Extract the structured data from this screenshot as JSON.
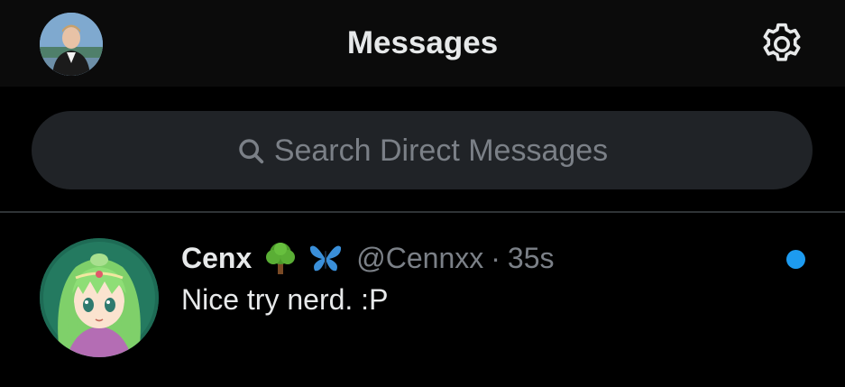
{
  "header": {
    "title": "Messages",
    "avatar_icon": "user-avatar",
    "settings_icon": "gear-icon"
  },
  "search": {
    "placeholder": "Search Direct Messages",
    "icon": "search-icon"
  },
  "conversations": [
    {
      "name": "Cenx",
      "emojis": [
        "tree-emoji",
        "butterfly-emoji"
      ],
      "handle": "@Cennxx",
      "separator": "·",
      "time": "35s",
      "message": "Nice try nerd. :P",
      "unread": true
    }
  ],
  "colors": {
    "background": "#000000",
    "header_bg": "#0b0b0b",
    "search_bg": "#202327",
    "muted_text": "#7b8087",
    "primary_text": "#e7e9ea",
    "unread_dot": "#1d9bf0",
    "divider": "#2f3336"
  }
}
